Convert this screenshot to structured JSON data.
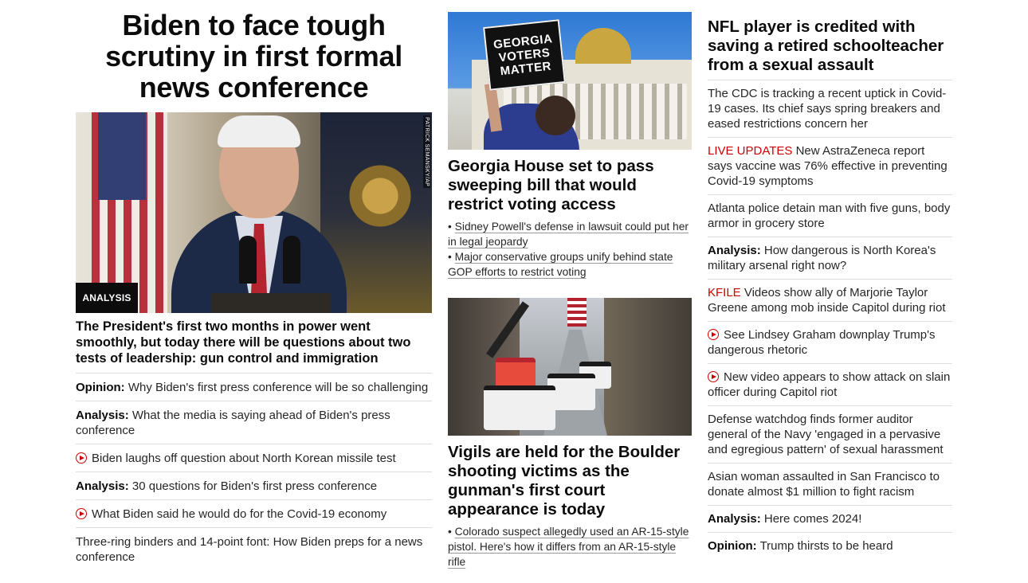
{
  "col1": {
    "headline": "Biden to face tough scrutiny in first formal news conference",
    "photo_credit": "PATRICK SEMANSKY/AP",
    "badge": "ANALYSIS",
    "description": "The President's first two months in power went smoothly, but today there will be questions about two tests of leadership: gun control and immigration",
    "items": [
      {
        "kicker": "Opinion:",
        "text": "Why Biden's first press conference will be so challenging"
      },
      {
        "kicker": "Analysis:",
        "text": "What the media is saying ahead of Biden's press conference"
      },
      {
        "video": true,
        "text": "Biden laughs off question about North Korean missile test"
      },
      {
        "kicker": "Analysis:",
        "text": "30 questions for Biden's first press conference"
      },
      {
        "video": true,
        "text": "What Biden said he would do for the Covid-19 economy"
      },
      {
        "text": "Three-ring binders and 14-point font: How Biden preps for a news conference"
      }
    ]
  },
  "col2": {
    "story1": {
      "sign_line1": "GEORGIA",
      "sign_line2": "VOTERS",
      "sign_line3": "MATTER",
      "headline": "Georgia House set to pass sweeping bill that would restrict voting access",
      "bullets": [
        "Sidney Powell's defense in lawsuit could put her in legal jeopardy",
        "Major conservative groups unify behind state GOP efforts to restrict voting"
      ]
    },
    "story2": {
      "headline": "Vigils are held for the Boulder shooting victims as the gunman's first court appearance is today",
      "bullets": [
        "Colorado suspect allegedly used an AR-15-style pistol. Here's how it differs from an AR-15-style rifle"
      ]
    }
  },
  "col3": {
    "headline": "NFL player is credited with saving a retired schoolteacher from a sexual assault",
    "items": [
      {
        "text": "The CDC is tracking a recent uptick in Covid-19 cases. Its chief says spring breakers and eased restrictions concern her"
      },
      {
        "red_kicker": "LIVE UPDATES",
        "text": "New AstraZeneca report says vaccine was 76% effective in preventing Covid-19 symptoms"
      },
      {
        "text": "Atlanta police detain man with five guns, body armor in grocery store"
      },
      {
        "kicker": "Analysis:",
        "text": "How dangerous is North Korea's military arsenal right now?"
      },
      {
        "red_kicker": "KFILE",
        "text": "Videos show ally of Marjorie Taylor Greene among mob inside Capitol during riot"
      },
      {
        "video": true,
        "text": "See Lindsey Graham downplay Trump's dangerous rhetoric"
      },
      {
        "video": true,
        "text": "New video appears to show attack on slain officer during Capitol riot"
      },
      {
        "text": "Defense watchdog finds former auditor general of the Navy 'engaged in a pervasive and egregious pattern' of sexual harassment"
      },
      {
        "text": "Asian woman assaulted in San Francisco to donate almost $1 million to fight racism"
      },
      {
        "kicker": "Analysis:",
        "text": "Here comes 2024!"
      },
      {
        "kicker": "Opinion:",
        "text": "Trump thirsts to be heard"
      }
    ]
  },
  "colors": {
    "accent_red": "#cc0000",
    "text": "#262626",
    "headline": "#0c0c0c",
    "divider": "#dddddd"
  }
}
